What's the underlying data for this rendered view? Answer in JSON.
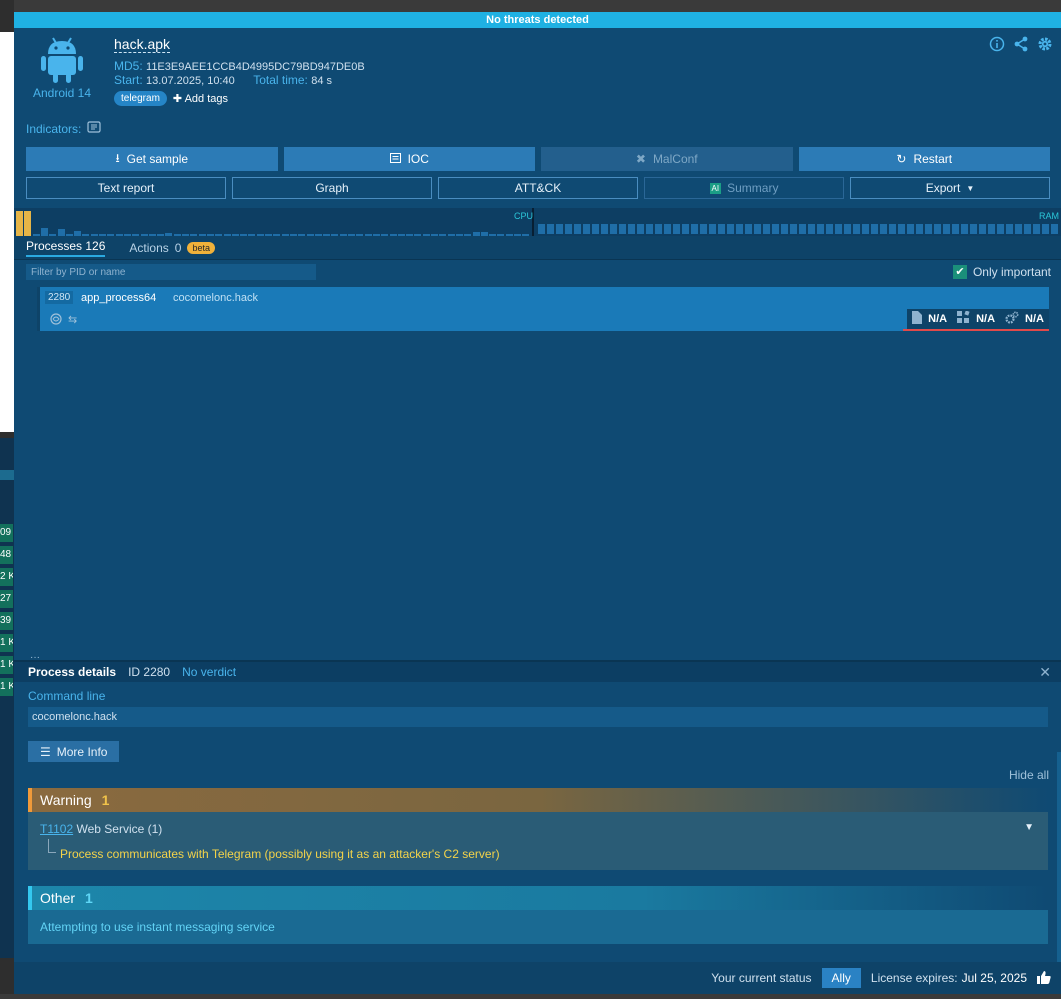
{
  "banner": "No threats detected",
  "left_edge": {
    "cells": [
      "09",
      "48",
      "2 K",
      "27",
      "39",
      "1 K",
      "1 K",
      "1 K"
    ]
  },
  "header": {
    "os_label": "Android 14",
    "file_name": "hack.apk",
    "md5_key": "MD5:",
    "md5": "11E3E9AEE1CCB4D4995DC79BD947DE0B",
    "start_key": "Start:",
    "start": "13.07.2025, 10:40",
    "total_key": "Total time:",
    "total": "84 s",
    "tag": "telegram",
    "add_tags": "Add tags"
  },
  "indicators_label": "Indicators:",
  "buttons_row1": {
    "get_sample": "Get sample",
    "ioc": "IOC",
    "malconf": "MalConf",
    "restart": "Restart"
  },
  "buttons_row2": {
    "text_report": "Text report",
    "graph": "Graph",
    "attck": "ATT&CK",
    "ai_badge": "AI",
    "summary": "Summary",
    "export": "Export"
  },
  "monitor": {
    "cpu_label": "CPU",
    "ram_label": "RAM",
    "cpu_levels": [
      0.95,
      0.95,
      0.05,
      0.3,
      0.08,
      0.25,
      0.05,
      0.2,
      0.05,
      0.05,
      0.05,
      0.05,
      0.05,
      0.05,
      0.05,
      0.05,
      0.05,
      0.05,
      0.1,
      0.05,
      0.05,
      0.05,
      0.05,
      0.05,
      0.05,
      0.05,
      0.05,
      0.05,
      0.05,
      0.05,
      0.05,
      0.05,
      0.05,
      0.05,
      0.05,
      0.05,
      0.05,
      0.05,
      0.05,
      0.05,
      0.05,
      0.05,
      0.05,
      0.05,
      0.05,
      0.05,
      0.05,
      0.05,
      0.05,
      0.05,
      0.05,
      0.05,
      0.05,
      0.05,
      0.05,
      0.15,
      0.15,
      0.05,
      0.05,
      0.05,
      0.05,
      0.05
    ]
  },
  "tabs": {
    "processes_label": "Processes",
    "processes_count": "126",
    "actions_label": "Actions",
    "actions_count": "0",
    "beta": "beta"
  },
  "filter": {
    "placeholder": "Filter by PID or name",
    "only_important": "Only important"
  },
  "process": {
    "pid": "2280",
    "name": "app_process64",
    "cmd": "cocomelonc.hack",
    "stat_files": "N/A",
    "stat_registry": "N/A",
    "stat_modules": "N/A"
  },
  "details": {
    "title": "Process details",
    "id": "ID 2280",
    "verdict": "No verdict",
    "cmdline_label": "Command line",
    "cmdline": "cocomelonc.hack",
    "more_info": "More Info",
    "hide_all": "Hide all",
    "warning_title": "Warning",
    "warning_count": "1",
    "technique_id": "T1102",
    "technique_name": " Web Service (1)",
    "warning_detail": "Process communicates with Telegram (possibly using it as an attacker's C2 server)",
    "other_title": "Other",
    "other_count": "1",
    "other_detail": "Attempting to use instant messaging service"
  },
  "statusbar": {
    "status_label": "Your current status",
    "status_value": "Ally",
    "license_label": "License expires:",
    "license_date": "Jul 25, 2025"
  },
  "colors": {
    "accent": "#1fb1e3",
    "warning": "#f09a3a",
    "other": "#34c8ef",
    "cpu_hot": "#e6b547"
  }
}
